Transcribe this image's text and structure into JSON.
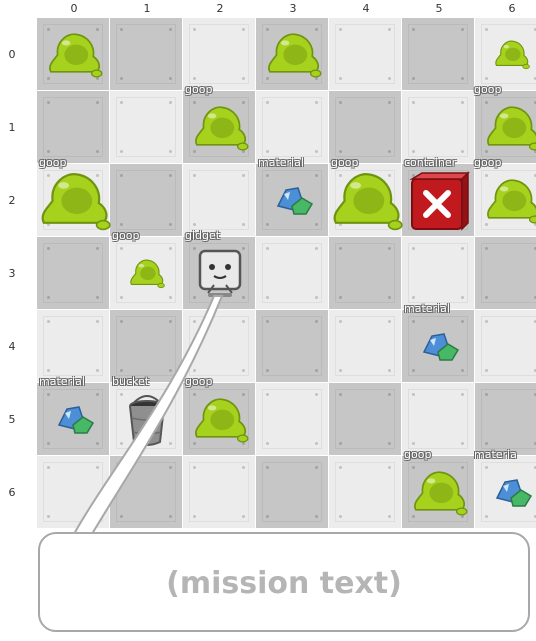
{
  "grid": {
    "columns": [
      "0",
      "1",
      "2",
      "3",
      "4",
      "5",
      "6"
    ],
    "rows": [
      "0",
      "1",
      "2",
      "3",
      "4",
      "5",
      "6"
    ],
    "shades": [
      [
        "dark",
        "dark",
        "light",
        "dark",
        "light",
        "dark",
        "light"
      ],
      [
        "dark",
        "light",
        "dark",
        "light",
        "dark",
        "light",
        "dark"
      ],
      [
        "light",
        "dark",
        "light",
        "dark",
        "light",
        "dark",
        "light"
      ],
      [
        "dark",
        "light",
        "dark",
        "light",
        "dark",
        "light",
        "dark"
      ],
      [
        "light",
        "dark",
        "light",
        "dark",
        "light",
        "dark",
        "light"
      ],
      [
        "dark",
        "light",
        "dark",
        "light",
        "dark",
        "light",
        "dark"
      ],
      [
        "light",
        "dark",
        "light",
        "dark",
        "light",
        "dark",
        "light"
      ]
    ]
  },
  "items": [
    {
      "type": "goop",
      "icon": "goop-blob-icon",
      "row": 0,
      "col": 0,
      "size": "big"
    },
    {
      "type": "goop",
      "icon": "goop-blob-icon",
      "row": 0,
      "col": 3,
      "size": "big"
    },
    {
      "type": "goop",
      "icon": "goop-blob-icon",
      "row": 0,
      "col": 6,
      "size": "small"
    },
    {
      "type": "goop",
      "icon": "goop-blob-icon",
      "row": 1,
      "col": 2,
      "size": "big"
    },
    {
      "type": "goop",
      "icon": "goop-blob-icon",
      "row": 1,
      "col": 6,
      "size": "big"
    },
    {
      "type": "goop",
      "icon": "goop-blob-icon",
      "row": 2,
      "col": 0,
      "size": "huge"
    },
    {
      "type": "material",
      "icon": "crystal-icon",
      "row": 2,
      "col": 3,
      "size": "small"
    },
    {
      "type": "goop",
      "icon": "goop-blob-icon",
      "row": 2,
      "col": 4,
      "size": "huge"
    },
    {
      "type": "container",
      "icon": "red-crate-x-icon",
      "row": 2,
      "col": 5,
      "size": "big"
    },
    {
      "type": "goop",
      "icon": "goop-blob-icon",
      "row": 2,
      "col": 6,
      "size": "big"
    },
    {
      "type": "goop",
      "icon": "goop-blob-icon",
      "row": 3,
      "col": 1,
      "size": "small"
    },
    {
      "type": "gidget",
      "icon": "gidget-robot-icon",
      "row": 3,
      "col": 2,
      "size": "big"
    },
    {
      "type": "material",
      "icon": "crystal-icon",
      "row": 4,
      "col": 5,
      "size": "small"
    },
    {
      "type": "material",
      "icon": "crystal-icon",
      "row": 5,
      "col": 0,
      "size": "small"
    },
    {
      "type": "bucket",
      "icon": "bucket-icon",
      "row": 5,
      "col": 1,
      "size": "big"
    },
    {
      "type": "goop",
      "icon": "goop-blob-icon",
      "row": 5,
      "col": 2,
      "size": "big"
    },
    {
      "type": "goop",
      "icon": "goop-blob-icon",
      "row": 6,
      "col": 5,
      "size": "big"
    },
    {
      "type": "material",
      "icon": "crystal-icon",
      "row": 6,
      "col": 6,
      "size": "small"
    }
  ],
  "labels": [
    {
      "text": "goop",
      "row": 1,
      "col": 2,
      "anchor": "top-left"
    },
    {
      "text": "goop",
      "row": 1,
      "col": 6,
      "anchor": "top-right"
    },
    {
      "text": "material",
      "row": 2,
      "col": 3,
      "anchor": "top-left"
    },
    {
      "text": "goop",
      "row": 2,
      "col": 4,
      "anchor": "top-left"
    },
    {
      "text": "container",
      "row": 2,
      "col": 5,
      "anchor": "top-left"
    },
    {
      "text": "goop",
      "row": 2,
      "col": 6,
      "anchor": "top-left"
    },
    {
      "text": "goop",
      "row": 2,
      "col": 0,
      "anchor": "top-left"
    },
    {
      "text": "goop",
      "row": 3,
      "col": 1,
      "anchor": "top-left"
    },
    {
      "text": "gidget",
      "row": 3,
      "col": 2,
      "anchor": "top-left"
    },
    {
      "text": "material",
      "row": 4,
      "col": 5,
      "anchor": "top-left"
    },
    {
      "text": "material",
      "row": 5,
      "col": 0,
      "anchor": "top-left"
    },
    {
      "text": "bucket",
      "row": 5,
      "col": 1,
      "anchor": "top-left"
    },
    {
      "text": "goop",
      "row": 5,
      "col": 2,
      "anchor": "top-left"
    },
    {
      "text": "goop",
      "row": 6,
      "col": 5,
      "anchor": "top-left"
    },
    {
      "text": "materia",
      "row": 6,
      "col": 6,
      "anchor": "top-left"
    }
  ],
  "mission_text": "(mission text)",
  "colors": {
    "goop": "#a6d11d",
    "goop_dark": "#6f9410",
    "crate": "#c0191e",
    "crystal_blue": "#4d8fd6",
    "crystal_green": "#46b866",
    "robot_body": "#e9e9e9",
    "bucket": "#8f8f8f"
  }
}
